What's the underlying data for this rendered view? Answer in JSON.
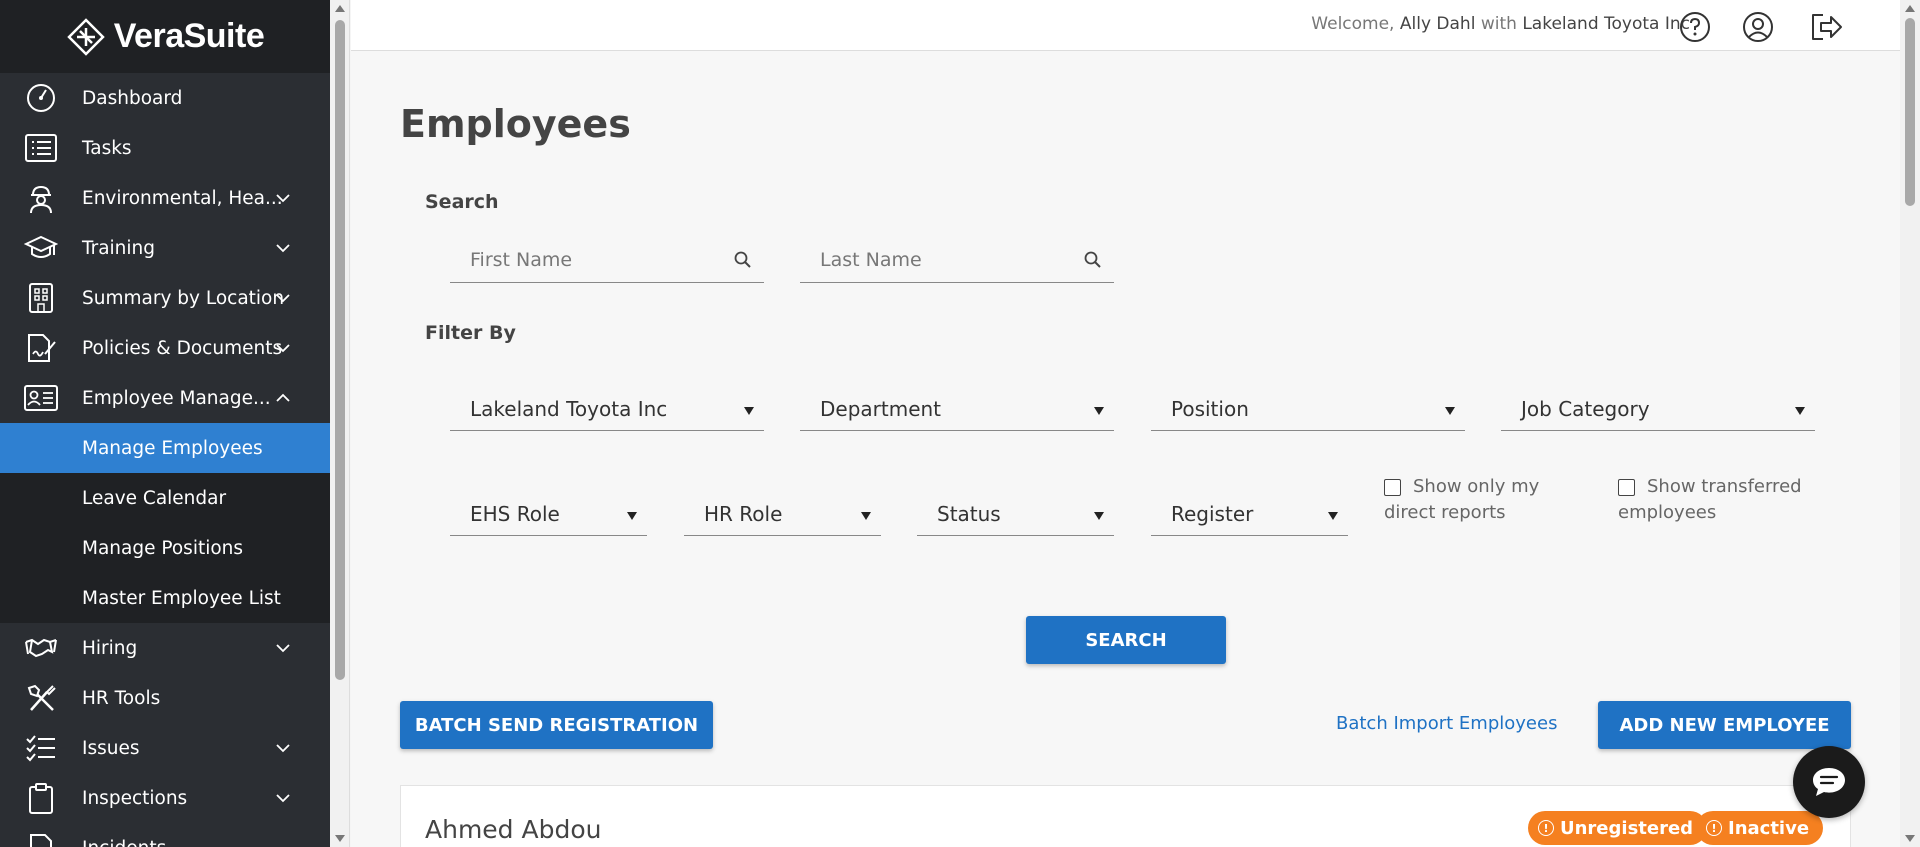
{
  "app": {
    "logo_text": "VeraSuite"
  },
  "sidebar": {
    "items": [
      {
        "label": "Dashboard",
        "icon": "dashboard-gauge-icon",
        "expandable": false
      },
      {
        "label": "Tasks",
        "icon": "list-icon",
        "expandable": false
      },
      {
        "label": "Environmental, Hea...",
        "icon": "worker-helmet-icon",
        "expandable": true
      },
      {
        "label": "Training",
        "icon": "graduation-cap-icon",
        "expandable": true
      },
      {
        "label": "Summary by Location",
        "icon": "building-icon",
        "expandable": true
      },
      {
        "label": "Policies & Documents",
        "icon": "document-signature-icon",
        "expandable": true
      },
      {
        "label": "Employee Manage...",
        "icon": "id-card-icon",
        "expandable": true,
        "expanded": true
      },
      {
        "label": "Hiring",
        "icon": "handshake-icon",
        "expandable": true
      },
      {
        "label": "HR Tools",
        "icon": "tools-icon",
        "expandable": false
      },
      {
        "label": "Issues",
        "icon": "checklist-icon",
        "expandable": true
      },
      {
        "label": "Inspections",
        "icon": "clipboard-icon",
        "expandable": true
      },
      {
        "label": "Incidents",
        "icon": "document-icon",
        "expandable": false
      }
    ],
    "sub_items": [
      {
        "label": "Manage Employees",
        "active": true
      },
      {
        "label": "Leave Calendar",
        "active": false
      },
      {
        "label": "Manage Positions",
        "active": false
      },
      {
        "label": "Master Employee List",
        "active": false
      }
    ]
  },
  "topbar": {
    "welcome_prefix": "Welcome,",
    "user_name": "Ally Dahl",
    "with_text": "with",
    "company": "Lakeland Toyota Inc"
  },
  "page": {
    "title": "Employees",
    "search_label": "Search",
    "first_name_placeholder": "First Name",
    "last_name_placeholder": "Last Name",
    "filter_label": "Filter By",
    "filters_row1": [
      "Lakeland Toyota Inc",
      "Department",
      "Position",
      "Job Category"
    ],
    "filters_row2": [
      "EHS Role",
      "HR Role",
      "Status",
      "Register"
    ],
    "check_direct_reports": "Show only my direct reports",
    "check_transferred": "Show transferred employees",
    "search_button": "SEARCH",
    "batch_send_button": "BATCH SEND REGISTRATION",
    "batch_import_link": "Batch Import Employees",
    "add_employee_button": "ADD NEW EMPLOYEE"
  },
  "employee": {
    "name": "Ahmed Abdou",
    "badges": [
      "Unregistered",
      "Inactive"
    ],
    "badge_color": "#f58020"
  },
  "colors": {
    "sidebar_bg": "#2b2e33",
    "active_blue": "#2f80d1",
    "button_blue": "#1f72c4",
    "badge_orange": "#f58020"
  }
}
